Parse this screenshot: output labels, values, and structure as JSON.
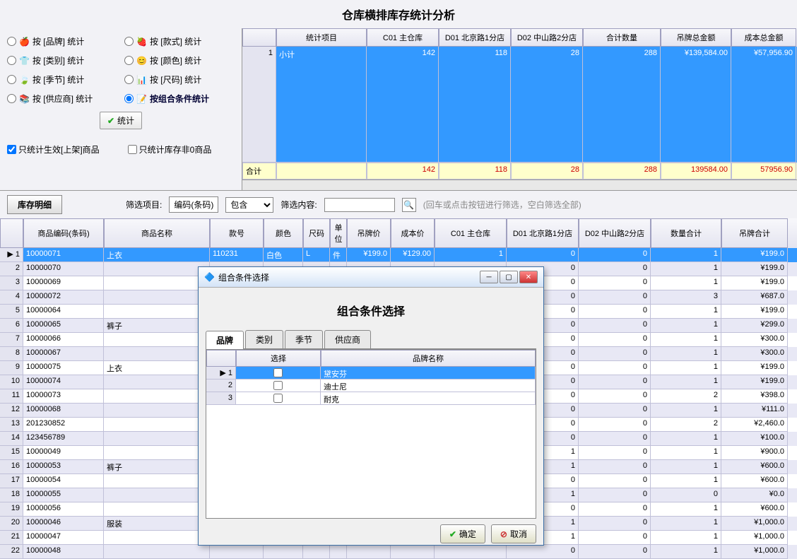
{
  "title": "仓库横排库存统计分析",
  "radios": {
    "brand": "按 [品牌] 统计",
    "style": "按 [款式] 统计",
    "category": "按 [类别] 统计",
    "color": "按 [颜色] 统计",
    "season": "按 [季节] 统计",
    "size": "按 [尺码] 统计",
    "supplier": "按 [供应商] 统计",
    "combo": "按组合条件统计"
  },
  "stat_btn": "统计",
  "chk1": "只统计生效[上架]商品",
  "chk2": "只统计库存非0商品",
  "top_headers": [
    "统计项目",
    "C01 主仓库",
    "D01 北京路1分店",
    "D02 中山路2分店",
    "合计数量",
    "吊牌总金额",
    "成本总金额"
  ],
  "top_row": {
    "idx": "1",
    "label": "小计",
    "c01": "142",
    "d01": "118",
    "d02": "28",
    "qty": "288",
    "amt": "¥139,584.00",
    "cost": "¥57,956.90"
  },
  "top_footer": {
    "label": "合计",
    "c01": "142",
    "d01": "118",
    "d02": "28",
    "qty": "288",
    "amt": "139584.00",
    "cost": "57956.90"
  },
  "detail_tab": "库存明细",
  "filter": {
    "label": "筛选项目:",
    "field": "编码(条码)",
    "op": "包含",
    "content_label": "筛选内容:",
    "hint": "(回车或点击按钮进行筛选，空白筛选全部)"
  },
  "detail_headers": [
    "商品编码(条码)",
    "商品名称",
    "款号",
    "颜色",
    "尺码",
    "单位",
    "吊牌价",
    "成本价",
    "C01 主仓库",
    "D01 北京路1分店",
    "D02 中山路2分店",
    "数量合计",
    "吊牌合计"
  ],
  "rows": [
    {
      "i": 1,
      "code": "10000071",
      "name": "上衣",
      "style": "110231",
      "color": "白色",
      "size": "L",
      "unit": "件",
      "price": "¥199.0",
      "cost": "¥129.00",
      "c01": "1",
      "d01": "0",
      "d02": "0",
      "qty": "1",
      "tag": "¥199.0"
    },
    {
      "i": 2,
      "code": "10000070",
      "name": "",
      "style": "",
      "color": "",
      "size": "",
      "unit": "",
      "price": "",
      "cost": "",
      "c01": "",
      "d01": "0",
      "d02": "0",
      "qty": "1",
      "tag": "¥199.0"
    },
    {
      "i": 3,
      "code": "10000069",
      "name": "",
      "style": "",
      "color": "",
      "size": "",
      "unit": "",
      "price": "",
      "cost": "",
      "c01": "",
      "d01": "0",
      "d02": "0",
      "qty": "1",
      "tag": "¥199.0"
    },
    {
      "i": 4,
      "code": "10000072",
      "name": "",
      "style": "",
      "color": "",
      "size": "",
      "unit": "",
      "price": "",
      "cost": "",
      "c01": "",
      "d01": "0",
      "d02": "0",
      "qty": "3",
      "tag": "¥687.0"
    },
    {
      "i": 5,
      "code": "10000064",
      "name": "",
      "style": "",
      "color": "",
      "size": "",
      "unit": "",
      "price": "",
      "cost": "",
      "c01": "",
      "d01": "0",
      "d02": "0",
      "qty": "1",
      "tag": "¥199.0"
    },
    {
      "i": 6,
      "code": "10000065",
      "name": "裤子",
      "style": "",
      "color": "",
      "size": "",
      "unit": "",
      "price": "",
      "cost": "",
      "c01": "",
      "d01": "0",
      "d02": "0",
      "qty": "1",
      "tag": "¥299.0"
    },
    {
      "i": 7,
      "code": "10000066",
      "name": "",
      "style": "",
      "color": "",
      "size": "",
      "unit": "",
      "price": "",
      "cost": "",
      "c01": "",
      "d01": "0",
      "d02": "0",
      "qty": "1",
      "tag": "¥300.0"
    },
    {
      "i": 8,
      "code": "10000067",
      "name": "",
      "style": "",
      "color": "",
      "size": "",
      "unit": "",
      "price": "",
      "cost": "",
      "c01": "",
      "d01": "0",
      "d02": "0",
      "qty": "1",
      "tag": "¥300.0"
    },
    {
      "i": 9,
      "code": "10000075",
      "name": "上衣",
      "style": "",
      "color": "",
      "size": "",
      "unit": "",
      "price": "",
      "cost": "",
      "c01": "",
      "d01": "0",
      "d02": "0",
      "qty": "1",
      "tag": "¥199.0"
    },
    {
      "i": 10,
      "code": "10000074",
      "name": "",
      "style": "",
      "color": "",
      "size": "",
      "unit": "",
      "price": "",
      "cost": "",
      "c01": "",
      "d01": "0",
      "d02": "0",
      "qty": "1",
      "tag": "¥199.0"
    },
    {
      "i": 11,
      "code": "10000073",
      "name": "",
      "style": "",
      "color": "",
      "size": "",
      "unit": "",
      "price": "",
      "cost": "",
      "c01": "",
      "d01": "0",
      "d02": "0",
      "qty": "2",
      "tag": "¥398.0"
    },
    {
      "i": 12,
      "code": "10000068",
      "name": "",
      "style": "",
      "color": "",
      "size": "",
      "unit": "",
      "price": "",
      "cost": "",
      "c01": "",
      "d01": "0",
      "d02": "0",
      "qty": "1",
      "tag": "¥111.0"
    },
    {
      "i": 13,
      "code": "201230852",
      "name": "",
      "style": "",
      "color": "",
      "size": "",
      "unit": "",
      "price": "",
      "cost": "",
      "c01": "",
      "d01": "0",
      "d02": "0",
      "qty": "2",
      "tag": "¥2,460.0"
    },
    {
      "i": 14,
      "code": "123456789",
      "name": "",
      "style": "",
      "color": "",
      "size": "",
      "unit": "",
      "price": "",
      "cost": "",
      "c01": "",
      "d01": "0",
      "d02": "0",
      "qty": "1",
      "tag": "¥100.0"
    },
    {
      "i": 15,
      "code": "10000049",
      "name": "",
      "style": "",
      "color": "",
      "size": "",
      "unit": "",
      "price": "",
      "cost": "",
      "c01": "",
      "d01": "1",
      "d02": "0",
      "qty": "1",
      "tag": "¥900.0"
    },
    {
      "i": 16,
      "code": "10000053",
      "name": "裤子",
      "style": "",
      "color": "",
      "size": "",
      "unit": "",
      "price": "",
      "cost": "",
      "c01": "",
      "d01": "1",
      "d02": "0",
      "qty": "1",
      "tag": "¥600.0"
    },
    {
      "i": 17,
      "code": "10000054",
      "name": "",
      "style": "",
      "color": "",
      "size": "",
      "unit": "",
      "price": "",
      "cost": "",
      "c01": "",
      "d01": "0",
      "d02": "0",
      "qty": "1",
      "tag": "¥600.0"
    },
    {
      "i": 18,
      "code": "10000055",
      "name": "",
      "style": "",
      "color": "",
      "size": "",
      "unit": "",
      "price": "",
      "cost": "",
      "c01": "",
      "d01": "1",
      "d02": "0",
      "qty": "0",
      "tag": "¥0.0"
    },
    {
      "i": 19,
      "code": "10000056",
      "name": "",
      "style": "",
      "color": "",
      "size": "",
      "unit": "",
      "price": "",
      "cost": "",
      "c01": "",
      "d01": "0",
      "d02": "0",
      "qty": "1",
      "tag": "¥600.0"
    },
    {
      "i": 20,
      "code": "10000046",
      "name": "服装",
      "style": "",
      "color": "",
      "size": "",
      "unit": "",
      "price": "",
      "cost": "",
      "c01": "",
      "d01": "1",
      "d02": "0",
      "qty": "1",
      "tag": "¥1,000.0"
    },
    {
      "i": 21,
      "code": "10000047",
      "name": "",
      "style": "",
      "color": "",
      "size": "",
      "unit": "",
      "price": "",
      "cost": "",
      "c01": "",
      "d01": "1",
      "d02": "0",
      "qty": "1",
      "tag": "¥1,000.0"
    },
    {
      "i": 22,
      "code": "10000048",
      "name": "",
      "style": "",
      "color": "",
      "size": "",
      "unit": "",
      "price": "",
      "cost": "",
      "c01": "",
      "d01": "0",
      "d02": "0",
      "qty": "1",
      "tag": "¥1,000.0"
    }
  ],
  "modal": {
    "title": "组合条件选择",
    "heading": "组合条件选择",
    "tabs": [
      "品牌",
      "类别",
      "季节",
      "供应商"
    ],
    "grid_headers": [
      "选择",
      "品牌名称"
    ],
    "rows": [
      {
        "i": 1,
        "name": "黛安芬"
      },
      {
        "i": 2,
        "name": "迪士尼"
      },
      {
        "i": 3,
        "name": "耐克"
      }
    ],
    "ok": "确定",
    "cancel": "取消"
  }
}
